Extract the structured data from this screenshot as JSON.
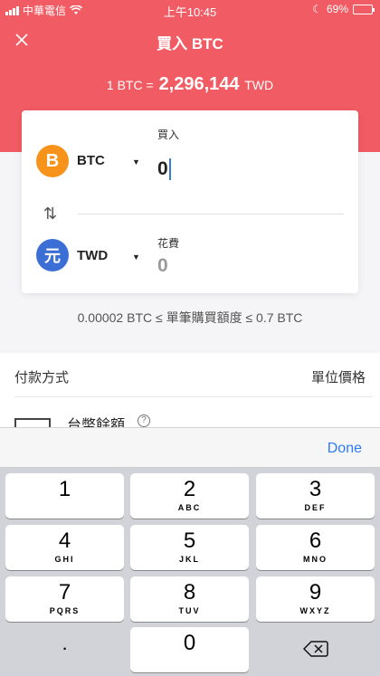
{
  "status_bar": {
    "carrier": "中華電信",
    "time": "上午10:45",
    "battery": "69%",
    "battery_level": 0.69
  },
  "nav": {
    "title": "買入 BTC",
    "close_icon": "close-icon"
  },
  "rate": {
    "prefix": "1 BTC =",
    "value": "2,296,144",
    "unit": "TWD"
  },
  "buy_card": {
    "from_currency": "BTC",
    "from_label": "買入",
    "from_amount": "0",
    "to_currency": "TWD",
    "to_label": "花費",
    "to_amount": "0",
    "btc_symbol": "B",
    "twd_symbol": "元",
    "swap_icon": "⇅"
  },
  "limit_text": "0.00002 BTC ≤ 單筆購買額度 ≤ 0.7 BTC",
  "payment": {
    "heading": "付款方式",
    "unit_price": "單位價格",
    "method": "台幣餘額",
    "help": "?"
  },
  "keyboard": {
    "done": "Done",
    "keys": [
      {
        "num": "1",
        "sub": ""
      },
      {
        "num": "2",
        "sub": "ABC"
      },
      {
        "num": "3",
        "sub": "DEF"
      },
      {
        "num": "4",
        "sub": "GHI"
      },
      {
        "num": "5",
        "sub": "JKL"
      },
      {
        "num": "6",
        "sub": "MNO"
      },
      {
        "num": "7",
        "sub": "PQRS"
      },
      {
        "num": "8",
        "sub": "TUV"
      },
      {
        "num": "9",
        "sub": "WXYZ"
      },
      {
        "num": ".",
        "sub": ""
      },
      {
        "num": "0",
        "sub": ""
      }
    ]
  }
}
